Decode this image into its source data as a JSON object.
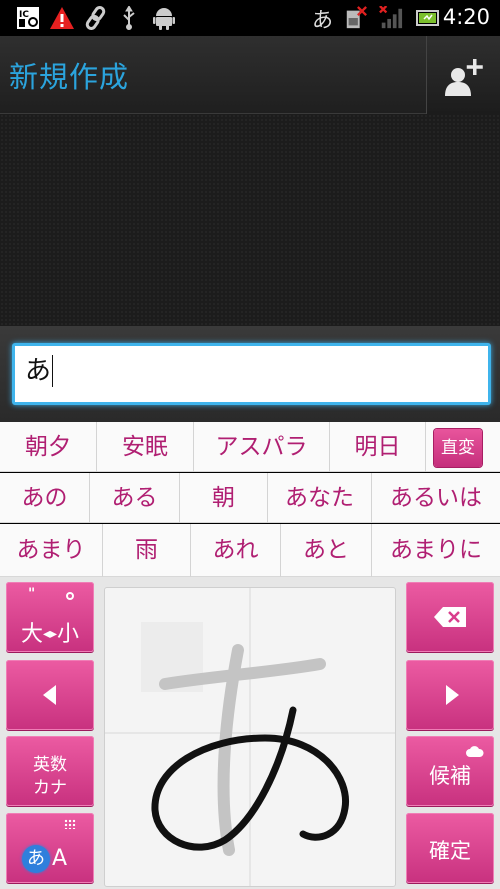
{
  "status_bar": {
    "ime_indicator": "あ",
    "time": "4:20",
    "icons": [
      "ic-card-icon",
      "warning-icon",
      "link-icon",
      "usb-icon",
      "android-debug-icon",
      "sim-error-icon",
      "signal-no-service-icon",
      "battery-icon"
    ]
  },
  "header": {
    "title": "新規作成",
    "add_contact_icon": "add-contact-icon"
  },
  "compose": {
    "input_value": "あ"
  },
  "candidates": {
    "row1": [
      "朝夕",
      "安眠",
      "アスパラ",
      "明日"
    ],
    "convert_label": "直変",
    "row2": [
      "あの",
      "ある",
      "朝",
      "あなた",
      "あるいは"
    ],
    "row3": [
      "あまり",
      "雨",
      "あれ",
      "あと",
      "あまりに"
    ]
  },
  "keyboard": {
    "case_toggle_label": "大◆小",
    "case_toggle_left": "大",
    "case_toggle_right": "小",
    "alnum_kana_line1": "英数",
    "alnum_kana_line2": "カナ",
    "mode_hiragana": "あ",
    "mode_alpha": "A",
    "candidates_label": "候補",
    "confirm_label": "確定",
    "handwriting_char": "あ"
  },
  "colors": {
    "accent": "#2ba4dd",
    "key_pink": "#d93d8c",
    "candidate_text": "#b01f72"
  }
}
